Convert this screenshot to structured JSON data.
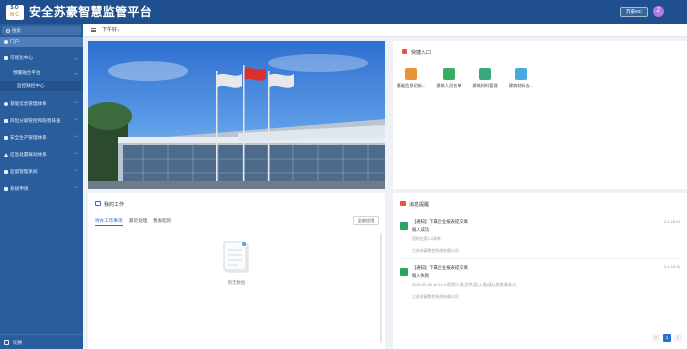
{
  "header": {
    "logo_top": "SO",
    "logo_bottom": "MC",
    "title": "安全苏豪智慧监管平台",
    "user_label": "苏豪MC",
    "avatar_letter": "Z",
    "brand_color": "#1f4f8f"
  },
  "sidebar": {
    "search_placeholder": "搜索",
    "items": [
      {
        "label": "门户",
        "icon": "circle-icon",
        "level": 0
      },
      {
        "label": "可视化中心",
        "icon": "monitor-icon",
        "level": 0
      },
      {
        "label": "预警融合平台",
        "level": 1
      },
      {
        "label": "监控联控中心",
        "level": 2
      },
      {
        "label": "基础信息管理体系",
        "icon": "gear-icon",
        "level": 0
      },
      {
        "label": "风险分级管控和隐患排查",
        "icon": "shield-icon",
        "level": 0
      },
      {
        "label": "安全生产管理体系",
        "icon": "shield-icon",
        "level": 0
      },
      {
        "label": "应急处置联动体系",
        "icon": "alert-icon",
        "level": 0
      },
      {
        "label": "监督管理系统",
        "icon": "eye-icon",
        "level": 0
      },
      {
        "label": "系统申请",
        "icon": "grid-icon",
        "level": 0
      }
    ],
    "footer_label": "切换",
    "bg_color": "#2a5d9c",
    "active_color": "#4f7fbd"
  },
  "tabbar": {
    "greeting": "下午好，"
  },
  "quick_entry": {
    "title": "快捷入口",
    "items": [
      {
        "label": "基础信息初始...",
        "color": "#e8933a"
      },
      {
        "label": "建筑人员名单",
        "color": "#3dab63"
      },
      {
        "label": "建筑材料管理",
        "color": "#3aa77a"
      },
      {
        "label": "建筑材料去...",
        "color": "#4ba7dc"
      }
    ]
  },
  "work": {
    "title": "我的工作",
    "tabs": [
      "待办工作事项",
      "最近处理",
      "我发起的"
    ],
    "all_button": "全部应用",
    "empty_label": "暂无数据"
  },
  "messages": {
    "title": "消息提醒",
    "items": [
      {
        "title": "【通知】下属企业报表提交填",
        "title2": "报入成功",
        "detail": "您的应用1.0表单",
        "org": "江苏苏豪数控系统有限公司",
        "time": "2-1 10:17"
      },
      {
        "title": "【通知】下属企业报表提交填",
        "title2": "报入失败",
        "detail": "2020-02-06 10:11:13您的人员(文件)类(入表)请认失败请求(2)",
        "org": "江苏苏豪数控系统有限公司",
        "time": "2-1 10:11"
      }
    ],
    "pagination": [
      "<",
      "1",
      ">"
    ]
  }
}
